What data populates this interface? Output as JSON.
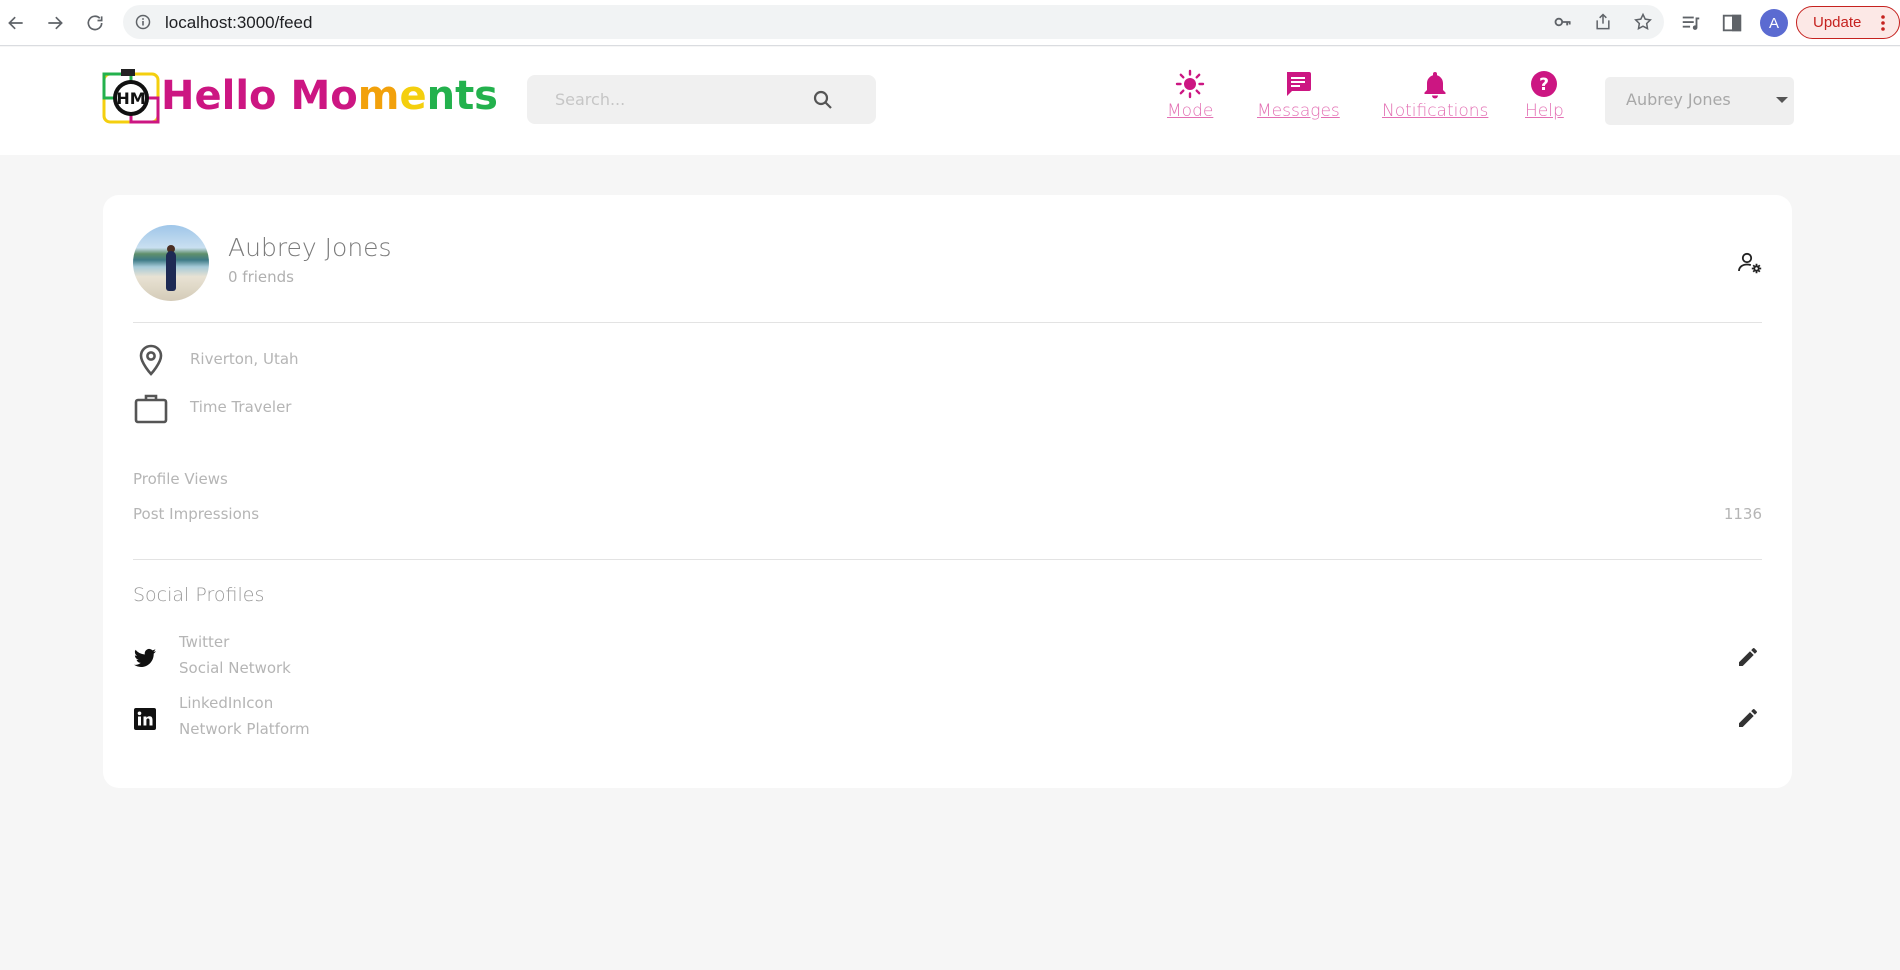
{
  "browser": {
    "url": "localhost:3000/feed",
    "profile_initial": "A",
    "update_label": "Update"
  },
  "app": {
    "logo": {
      "text_parts": [
        "Hello",
        " ",
        "Mo",
        "m",
        "e",
        "n",
        "ts"
      ],
      "colors": [
        "#cc1682",
        "#cc1682",
        "#cc1682",
        "#f2a10b",
        "#f4cf0e",
        "#23b14d",
        "#23b14d"
      ],
      "mark_text": "HM"
    },
    "search": {
      "placeholder": "Search..."
    },
    "nav": {
      "mode": "Mode",
      "messages": "Messages",
      "notifications": "Notifications",
      "help": "Help"
    },
    "user_menu": {
      "selected": "Aubrey Jones"
    },
    "accent_color": "#cc1682"
  },
  "profile": {
    "name": "Aubrey Jones",
    "friends": "0 friends",
    "location": "Riverton, Utah",
    "occupation": "Time Traveler",
    "stats": {
      "profile_views_label": "Profile Views",
      "profile_views_value": "",
      "post_impressions_label": "Post Impressions",
      "post_impressions_value": "1136"
    },
    "social_title": "Social Profiles",
    "socials": [
      {
        "icon": "twitter-icon",
        "name": "Twitter",
        "sub": "Social Network"
      },
      {
        "icon": "linkedin-icon",
        "name": "LinkedInIcon",
        "sub": "Network Platform"
      }
    ]
  }
}
